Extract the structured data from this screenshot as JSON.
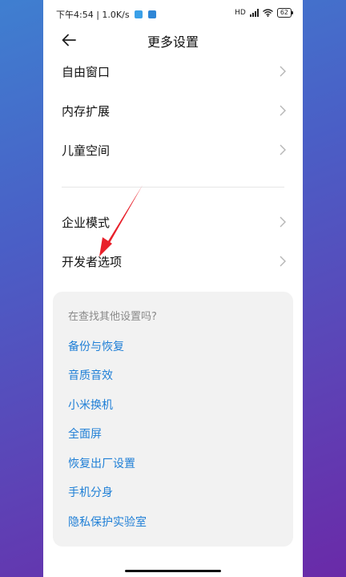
{
  "status_bar": {
    "time": "下午4:54",
    "speed": "1.0K/s",
    "network": "HD",
    "battery": "62"
  },
  "header": {
    "title": "更多设置"
  },
  "settings_items": [
    {
      "label": "自由窗口"
    },
    {
      "label": "内存扩展"
    },
    {
      "label": "儿童空间"
    },
    {
      "label": "企业模式"
    },
    {
      "label": "开发者选项"
    }
  ],
  "suggestions": {
    "title": "在查找其他设置吗?",
    "links": [
      {
        "label": "备份与恢复"
      },
      {
        "label": "音质音效"
      },
      {
        "label": "小米换机"
      },
      {
        "label": "全面屏"
      },
      {
        "label": "恢复出厂设置"
      },
      {
        "label": "手机分身"
      },
      {
        "label": "隐私保护实验室"
      }
    ]
  },
  "colors": {
    "accent_link": "#1f7fd6",
    "annotation_arrow": "#e8202a"
  }
}
